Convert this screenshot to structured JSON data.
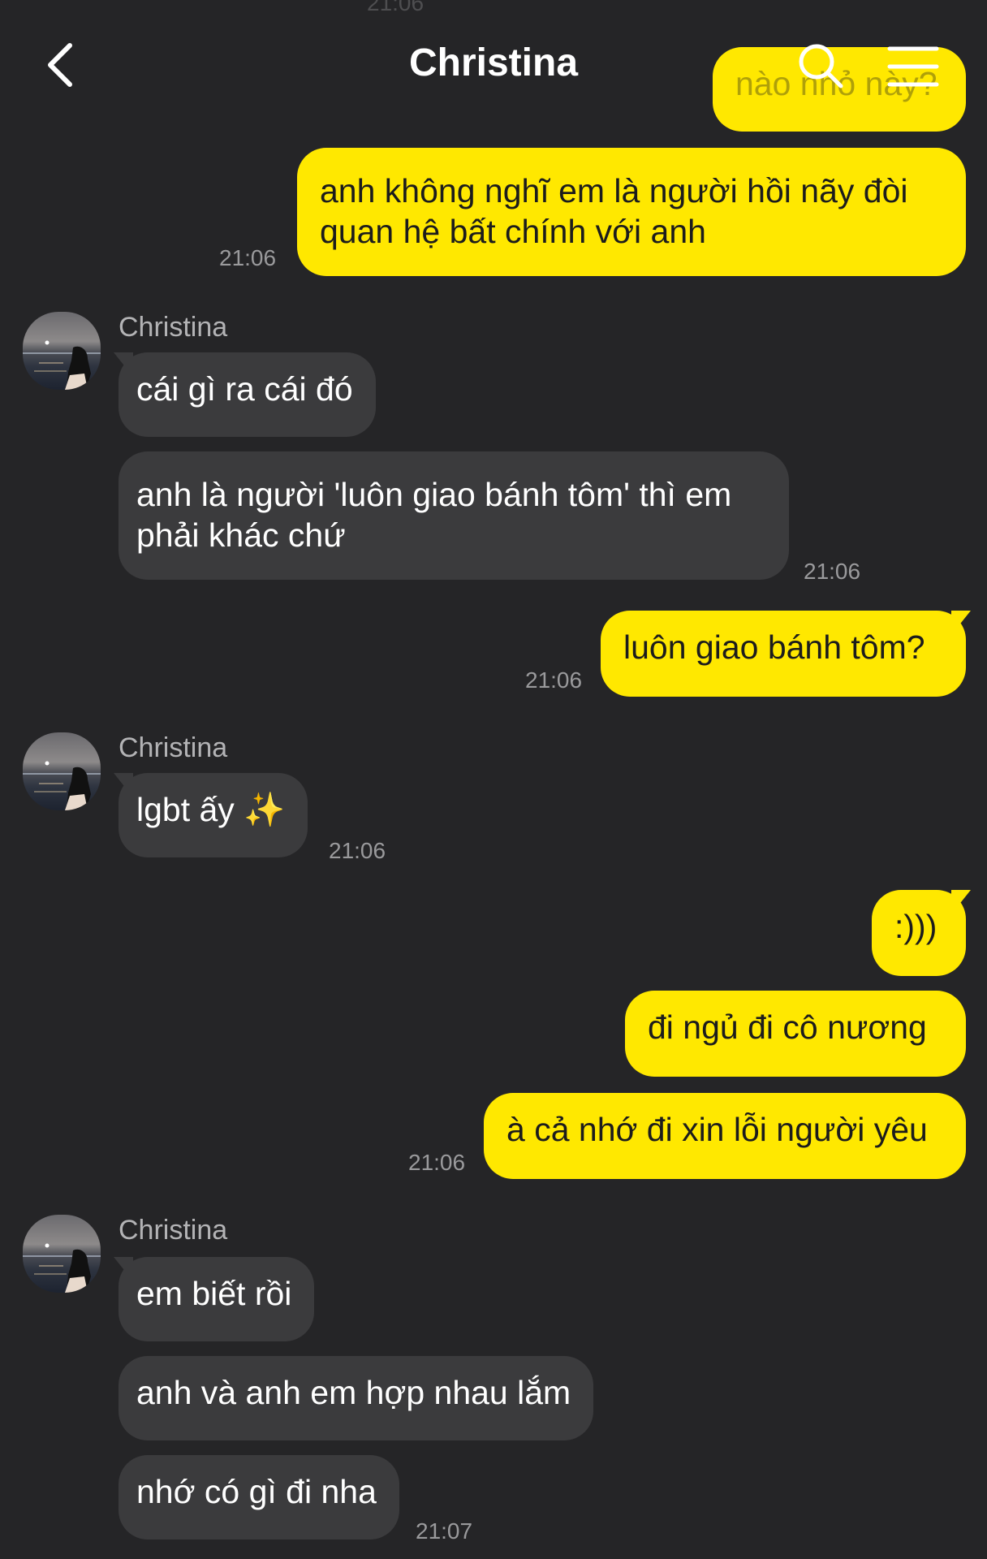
{
  "header": {
    "title": "Christina",
    "back_icon": "chevron-left-icon",
    "search_icon": "search-icon",
    "menu_icon": "hamburger-menu-icon"
  },
  "colors": {
    "background": "#252527",
    "outgoing_bubble": "#ffe800",
    "incoming_bubble": "#3b3b3d",
    "timestamp": "#9a9a9c"
  },
  "messages": {
    "top_time_partial": "21:06",
    "m0": "nào nhỏ này?",
    "m1_line1": "anh không nghĩ em là người hồi nãy đòi",
    "m1_line2": "quan hệ bất chính với anh",
    "t1": "21:06",
    "sender1": "Christina",
    "m2": "cái gì ra cái đó",
    "m3_line1": "anh là người 'luôn giao bánh tôm' thì em",
    "m3_line2": "phải khác chứ",
    "t2": "21:06",
    "m4": "luôn giao bánh tôm?",
    "t3": "21:06",
    "sender2": "Christina",
    "m5": "lgbt ấy ✨",
    "t4": "21:06",
    "m6": ":)))",
    "m7": "đi ngủ đi cô nương",
    "m8": "à cả nhớ đi xin lỗi người yêu",
    "t5": "21:06",
    "sender3": "Christina",
    "m9": "em biết rồi",
    "m10": "anh và anh em hợp nhau lắm",
    "m11": "nhớ có gì đi nha",
    "t6": "21:07"
  }
}
